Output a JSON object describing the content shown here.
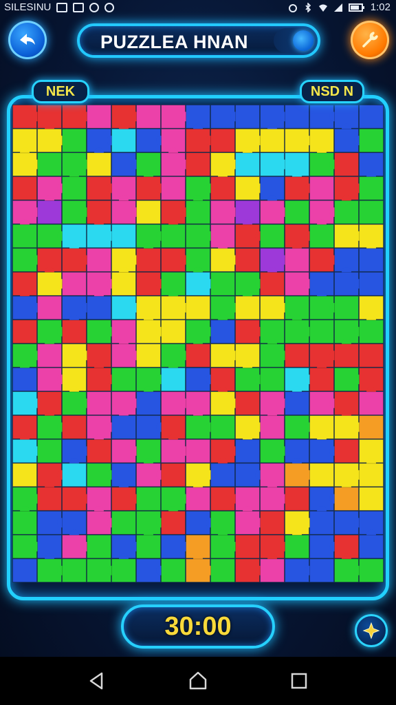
{
  "status_bar": {
    "carrier": "SILESINU",
    "time": "1:02",
    "icons": [
      "notification-icon",
      "image-icon",
      "circle-icon",
      "logo-icon",
      "alarm-icon",
      "bluetooth-icon",
      "wifi-icon",
      "signal-icon",
      "battery-icon"
    ]
  },
  "header": {
    "title": "PUZZLEA HNAN",
    "back_icon": "back-arrow-icon",
    "settings_icon": "wrench-icon"
  },
  "tags": {
    "left": "NEK",
    "right": "NSD N"
  },
  "board": {
    "columns": 15,
    "rows": 20,
    "palette": {
      "R": "#e62a2a",
      "G": "#1fd12c",
      "B": "#1f4fe0",
      "Y": "#f5e312",
      "P": "#ec3aa6",
      "C": "#23d8f0",
      "V": "#9a31d8",
      "O": "#f59a1c",
      "T": "#16a38a"
    },
    "rows_colors": [
      "RRRPRPPBBBBBBBB",
      "YYGBCBPRRYYYYBG",
      "YGGYBGPRYCCCGRB",
      "RPGRPRPGRYBRPRG",
      "PVGRPYRGPVPGPGG",
      "GGCCCGGGPRGRGYY",
      "GRRPYRRGYRVPRBB",
      "RYPPYRGCGGRPBBB",
      "BPBBCYYYGYYGGGY",
      "RGRGPYYGBRGGGGG",
      "GPYRPYGRYYGRRRR",
      "BPYRGGCBRGGCRGR",
      "CRGPPBPPYRPBPRP",
      "RGRPBBRGGYPGYYO",
      "CGBRPGPPRBGBBRY",
      "YRCGBPRYBBPOYYY",
      "GRRPRGGPRPPRBOY",
      "GBBPGGRBGPRYBBB",
      "GBPGBGBOGRRGBRB",
      "BGGGGBGOGRPBBGG"
    ]
  },
  "timer": {
    "value": "30:00"
  },
  "controls": {
    "star_icon": "star-icon"
  },
  "nav": {
    "back": "nav-back-icon",
    "home": "nav-home-icon",
    "recent": "nav-recent-icon"
  }
}
